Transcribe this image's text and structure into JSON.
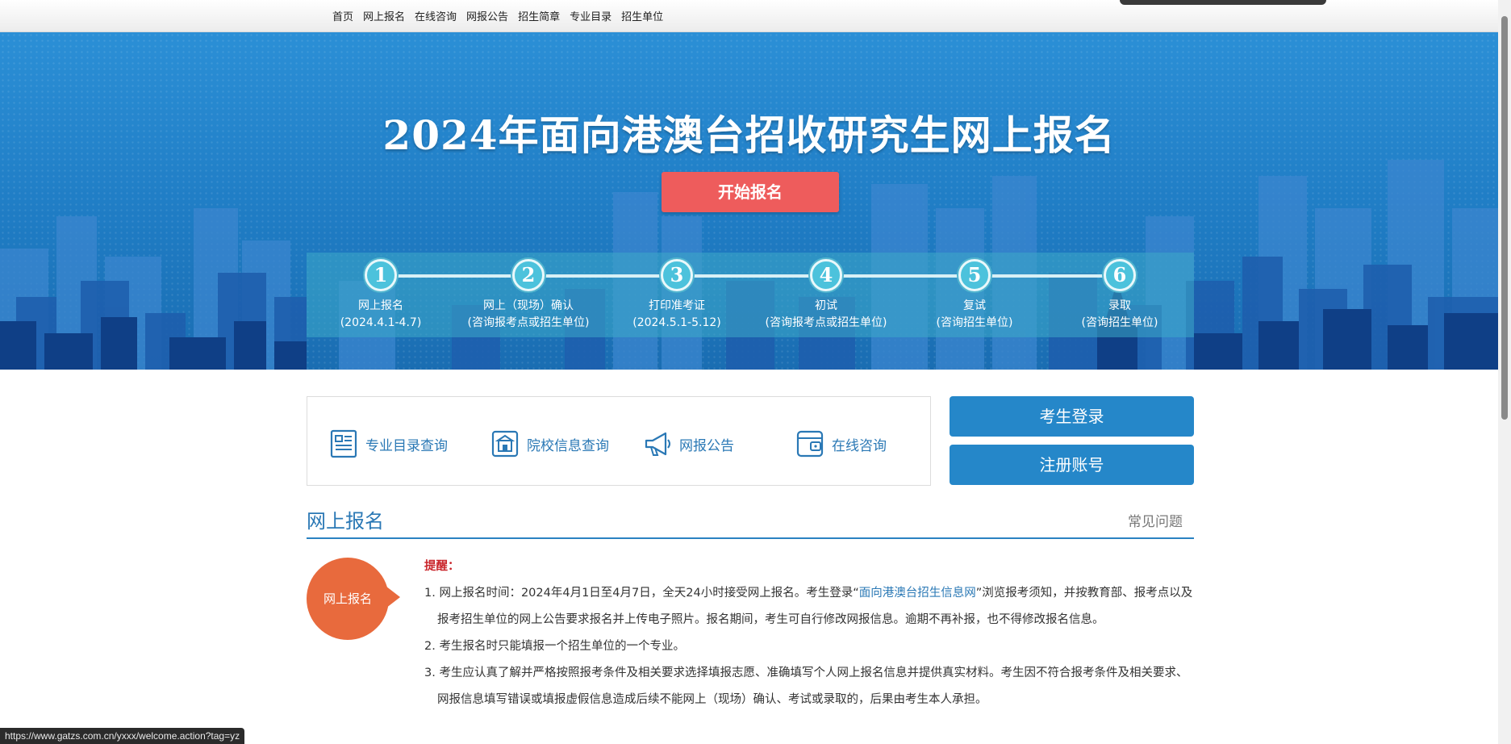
{
  "nav": {
    "items": [
      "首页",
      "网上报名",
      "在线咨询",
      "网报公告",
      "招生简章",
      "专业目录",
      "招生单位"
    ]
  },
  "banner": {
    "title": "2024年面向港澳台招收研究生网上报名",
    "start_button": "开始报名",
    "steps": [
      {
        "num": "1",
        "label": "网上报名",
        "sub": "(2024.4.1-4.7)"
      },
      {
        "num": "2",
        "label": "网上（现场）确认",
        "sub": "(咨询报考点或招生单位)"
      },
      {
        "num": "3",
        "label": "打印准考证",
        "sub": "(2024.5.1-5.12)"
      },
      {
        "num": "4",
        "label": "初试",
        "sub": "(咨询报考点或招生单位)"
      },
      {
        "num": "5",
        "label": "复试",
        "sub": "(咨询招生单位)"
      },
      {
        "num": "6",
        "label": "录取",
        "sub": "(咨询招生单位)"
      }
    ]
  },
  "quick_links": [
    {
      "label": "专业目录查询",
      "icon": "catalog-document-icon"
    },
    {
      "label": "院校信息查询",
      "icon": "school-building-icon"
    },
    {
      "label": "网报公告",
      "icon": "megaphone-icon"
    },
    {
      "label": "在线咨询",
      "icon": "chat-folder-icon"
    }
  ],
  "account": {
    "login": "考生登录",
    "register": "注册账号"
  },
  "section": {
    "title": "网上报名",
    "faq": "常见问题",
    "bubble": "网上报名",
    "remind": "提醒：",
    "items": [
      {
        "pre": "1. 网上报名时间：2024年4月1日至4月7日，全天24小时接受网上报名。考生登录“",
        "link": "面向港澳台招生信息网",
        "post": "”浏览报考须知，并按教育部、报考点以及报考招生单位的网上公告要求报名并上传电子照片。报名期间，考生可自行修改网报信息。逾期不再补报，也不得修改报名信息。"
      },
      {
        "pre": "2. 考生报名时只能填报一个招生单位的一个专业。",
        "link": "",
        "post": ""
      },
      {
        "pre": "3. 考生应认真了解并严格按照报考条件及相关要求选择填报志愿、准确填写个人网上报名信息并提供真实材料。考生因不符合报考条件及相关要求、网报信息填写错误或填报虚假信息造成后续不能网上（现场）确认、考试或录取的，后果由考生本人承担。",
        "link": "",
        "post": ""
      }
    ]
  },
  "status_url": "https://www.gatzs.com.cn/yxxx/welcome.action?tag=yz",
  "colors": {
    "banner_blue": "#2587c9",
    "start_button": "#ee5c5c",
    "bubble": "#e86a3d",
    "link": "#2a78b5",
    "remind": "#c9252b"
  }
}
